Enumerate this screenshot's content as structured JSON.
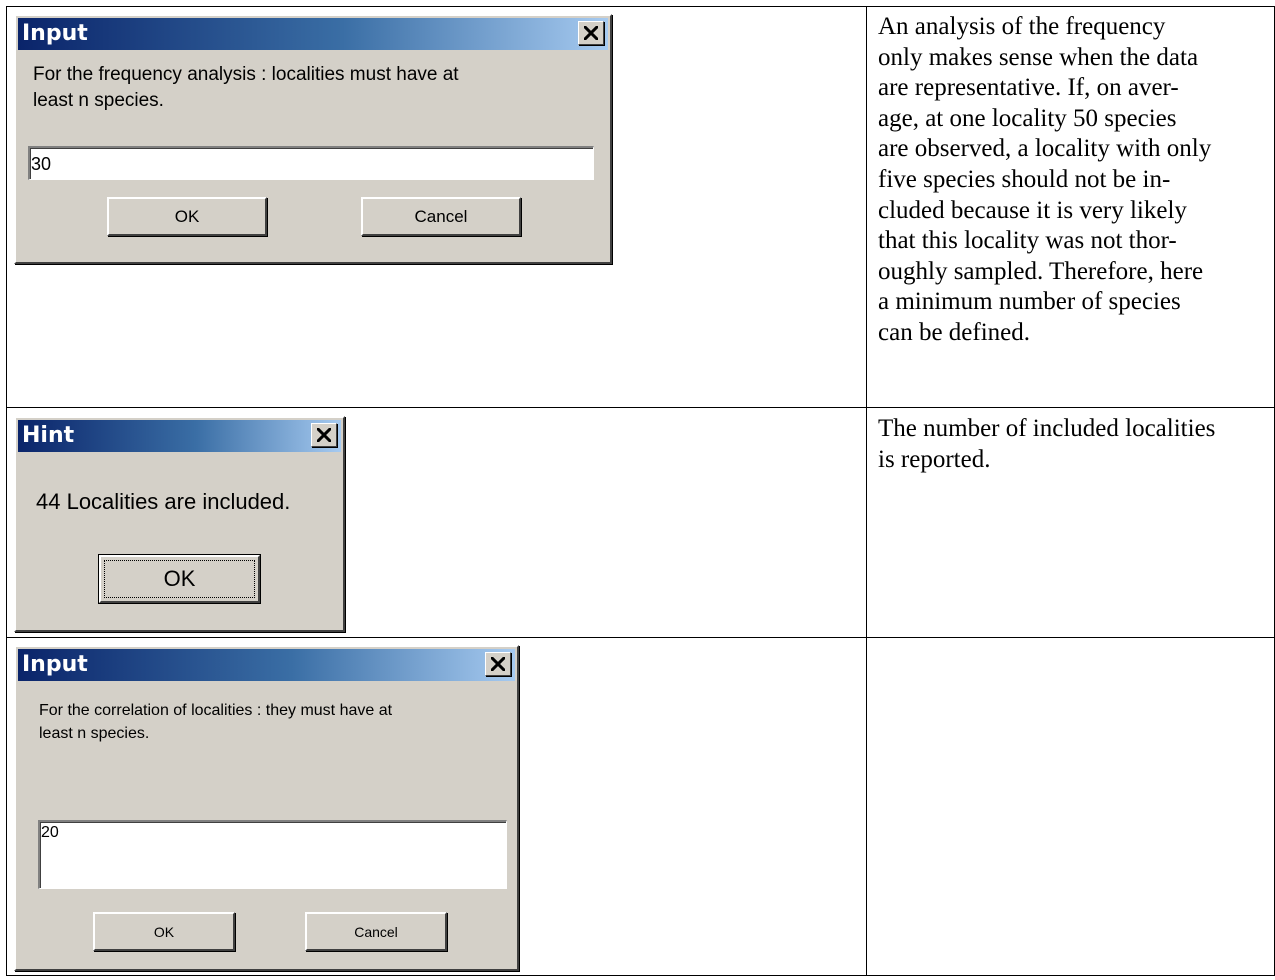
{
  "rows": [
    {
      "dialog": {
        "title": "Input",
        "prompt_lines": [
          "For the frequency analysis : localities must have at",
          "least n species."
        ],
        "input_value": "30",
        "ok_label": "OK",
        "cancel_label": "Cancel"
      },
      "description_lines": [
        "An analysis of the frequency",
        "only makes sense when the data",
        "are representative. If, on aver-",
        "age, at one locality 50 species",
        "are observed, a locality with only",
        "five species should not be in-",
        "cluded because it is very likely",
        "that this locality was not thor-",
        "oughly sampled. Therefore, here",
        "a minimum number of species",
        "can be defined."
      ]
    },
    {
      "dialog": {
        "title": "Hint",
        "message": "44 Localities are included.",
        "ok_label": "OK"
      },
      "description_lines": [
        "The number of included localities",
        "is reported."
      ]
    },
    {
      "dialog": {
        "title": "Input",
        "prompt_lines": [
          "For the correlation of localities : they must have at",
          "least n species."
        ],
        "input_value": "20",
        "ok_label": "OK",
        "cancel_label": "Cancel"
      },
      "description_lines": []
    }
  ],
  "icons": {
    "close": "close-icon"
  },
  "colors": {
    "dialog_face": "#d4d0c8",
    "title_gradient_start": "#0a246a",
    "title_gradient_end": "#a6caf0",
    "grid": "#000000"
  }
}
